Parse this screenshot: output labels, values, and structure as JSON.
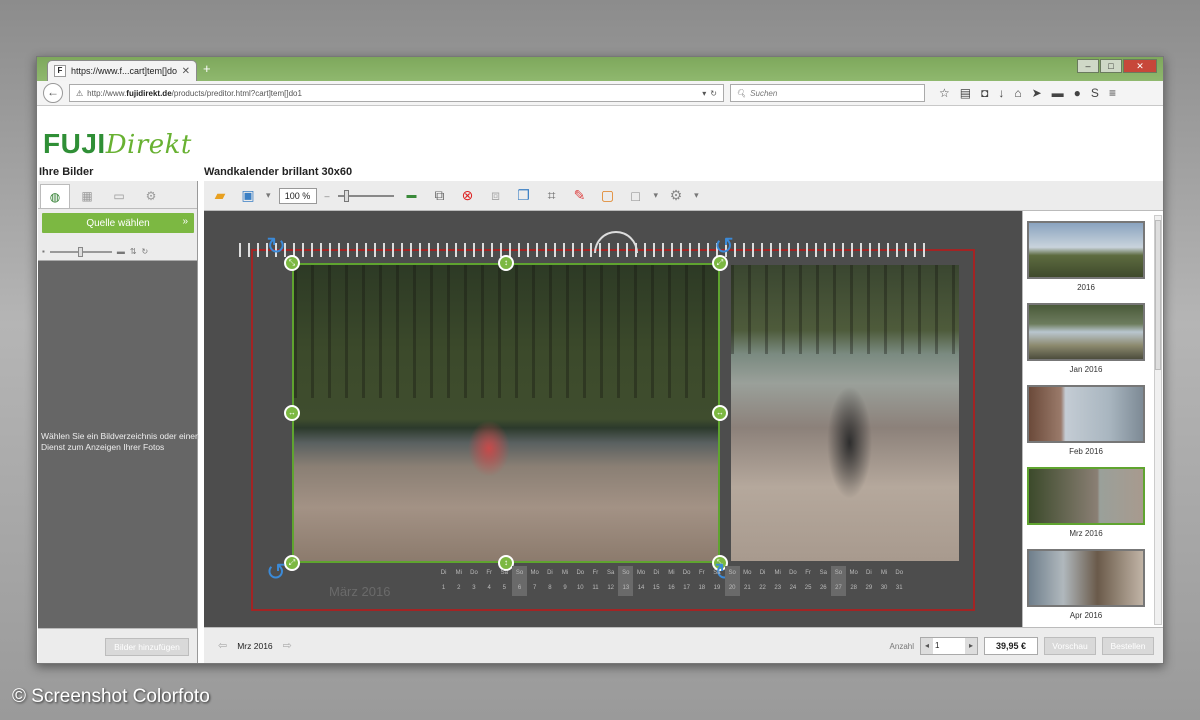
{
  "browser": {
    "tab_title": "https://www.f...cart]tem[]do1",
    "tab_favicon": "F",
    "url_prefix": "http://www.",
    "url_domain": "fujidirekt.de",
    "url_path": "/products/preditor.html?cart]tem[]do1",
    "search_placeholder": "Suchen"
  },
  "logo": {
    "part1": "FUJI",
    "part2": "Direkt"
  },
  "left_panel": {
    "title": "Ihre Bilder",
    "source_button": "Quelle wählen",
    "message": "Wählen Sie ein Bildverzeichnis oder einen Dienst zum Anzeigen Ihrer Fotos",
    "add_button": "Bilder hinzufügen"
  },
  "editor": {
    "title": "Wandkalender brillant 30x60",
    "zoom": "100 %"
  },
  "calendar": {
    "month_label": "März 2016",
    "weekdays": [
      "Di",
      "Mi",
      "Do",
      "Fr",
      "Sa",
      "So",
      "Mo",
      "Di",
      "Mi",
      "Do",
      "Fr",
      "Sa",
      "So",
      "Mo",
      "Di",
      "Mi",
      "Do",
      "Fr",
      "Sa",
      "So",
      "Mo",
      "Di",
      "Mi",
      "Do",
      "Fr",
      "Sa",
      "So",
      "Mo",
      "Di",
      "Mi",
      "Do"
    ],
    "days": [
      "1",
      "2",
      "3",
      "4",
      "5",
      "6",
      "7",
      "8",
      "9",
      "10",
      "11",
      "12",
      "13",
      "14",
      "15",
      "16",
      "17",
      "18",
      "19",
      "20",
      "21",
      "22",
      "23",
      "24",
      "25",
      "26",
      "27",
      "28",
      "29",
      "30",
      "31"
    ],
    "weekend_days": [
      6,
      13,
      20,
      27
    ]
  },
  "thumbnails": [
    {
      "label": "2016",
      "selected": false
    },
    {
      "label": "Jan 2016",
      "selected": false
    },
    {
      "label": "Feb 2016",
      "selected": false
    },
    {
      "label": "Mrz 2016",
      "selected": true
    },
    {
      "label": "Apr 2016",
      "selected": false
    }
  ],
  "footer": {
    "month": "Mrz 2016",
    "qty_label": "Anzahl",
    "qty_value": "1",
    "price": "39,95 €",
    "preview_button": "Vorschau",
    "order_button": "Bestellen"
  },
  "credit": "© Screenshot Colorfoto",
  "colors": {
    "brand_green": "#2f8f36",
    "accent_green": "#7cb842",
    "page_border": "#a32424",
    "rotate_blue": "#3b8ad8"
  }
}
